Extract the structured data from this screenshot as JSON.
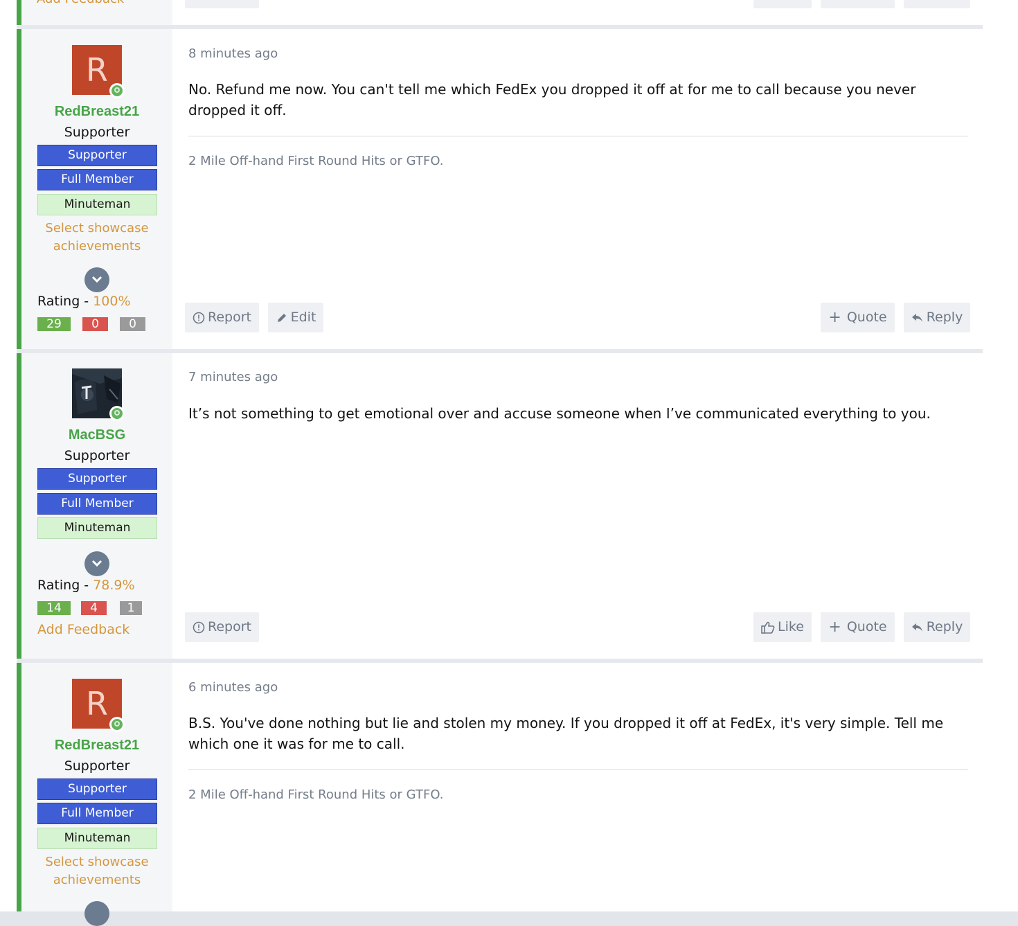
{
  "colors": {
    "accent_green": "#47a447",
    "link_orange": "#d4973d",
    "banner_blue": "#3f5ed6",
    "banner_green": "#d7f4d2",
    "muted": "#747d8a"
  },
  "previous_post": {
    "add_feedback": "Add Feedback"
  },
  "posts": [
    {
      "time": "8 minutes ago",
      "body": "No. Refund me now. You can't tell me which FedEx you dropped it off at for me to call because you never dropped it off.",
      "signature": "2 Mile Off-hand First Round Hits or GTFO.",
      "user": {
        "avatar_letter": "R",
        "name": "RedBreast21",
        "title": "Supporter",
        "banners": [
          "Supporter",
          "Full Member",
          "Minuteman"
        ],
        "showcase_link": "Select showcase achievements",
        "rating_label": "Rating -",
        "rating_pct": "100%",
        "positive": "29",
        "negative": "0",
        "neutral": "0"
      },
      "actions": {
        "report": "Report",
        "edit": "Edit",
        "quote": "Quote",
        "reply": "Reply"
      }
    },
    {
      "time": "7 minutes ago",
      "body": "It’s not something to get emotional over and accuse someone when I’ve communicated everything to you.",
      "user": {
        "name": "MacBSG",
        "title": "Supporter",
        "banners": [
          "Supporter",
          "Full Member",
          "Minuteman"
        ],
        "rating_label": "Rating -",
        "rating_pct": "78.9%",
        "positive": "14",
        "negative": "4",
        "neutral": "1",
        "add_feedback": "Add Feedback"
      },
      "actions": {
        "report": "Report",
        "like": "Like",
        "quote": "Quote",
        "reply": "Reply"
      }
    },
    {
      "time": "6 minutes ago",
      "body": "B.S. You've done nothing but lie and stolen my money. If you dropped it off at FedEx, it's very simple. Tell me which one it was for me to call.",
      "signature": "2 Mile Off-hand First Round Hits or GTFO.",
      "user": {
        "avatar_letter": "R",
        "name": "RedBreast21",
        "title": "Supporter",
        "banners": [
          "Supporter",
          "Full Member",
          "Minuteman"
        ],
        "showcase_link": "Select showcase achievements"
      }
    }
  ]
}
